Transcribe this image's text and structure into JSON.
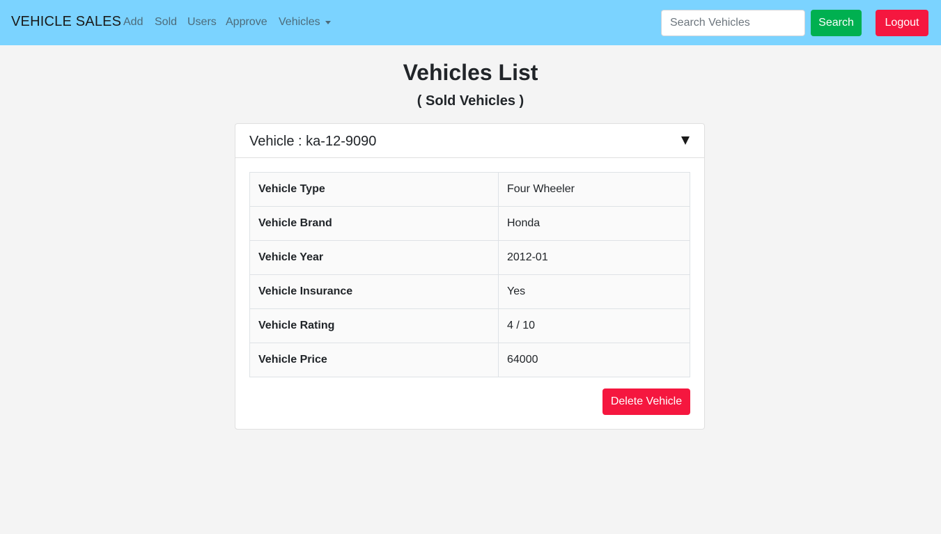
{
  "navbar": {
    "brand": "VEHICLE SALES",
    "links": [
      "Add",
      "Sold",
      "Users",
      "Approve"
    ],
    "dropdown_label": "Vehicles",
    "search_placeholder": "Search Vehicles",
    "search_label": "Search",
    "logout_label": "Logout",
    "background_color": "#7bd3ff"
  },
  "page": {
    "title": "Vehicles List",
    "subtitle": "( Sold Vehicles )"
  },
  "vehicle": {
    "header": "Vehicle : ka-12-9090",
    "toggle_icon": "triangle-down-icon",
    "details": [
      {
        "label": "Vehicle Type",
        "value": "Four Wheeler"
      },
      {
        "label": "Vehicle Brand",
        "value": "Honda"
      },
      {
        "label": "Vehicle Year",
        "value": "2012-01"
      },
      {
        "label": "Vehicle Insurance",
        "value": "Yes"
      },
      {
        "label": "Vehicle Rating",
        "value": "4 / 10"
      },
      {
        "label": "Vehicle Price",
        "value": "64000"
      }
    ],
    "delete_label": "Delete Vehicle"
  },
  "colors": {
    "search_button": "#00b050",
    "danger_button": "#f5173f",
    "page_background": "#f4f4f4"
  }
}
